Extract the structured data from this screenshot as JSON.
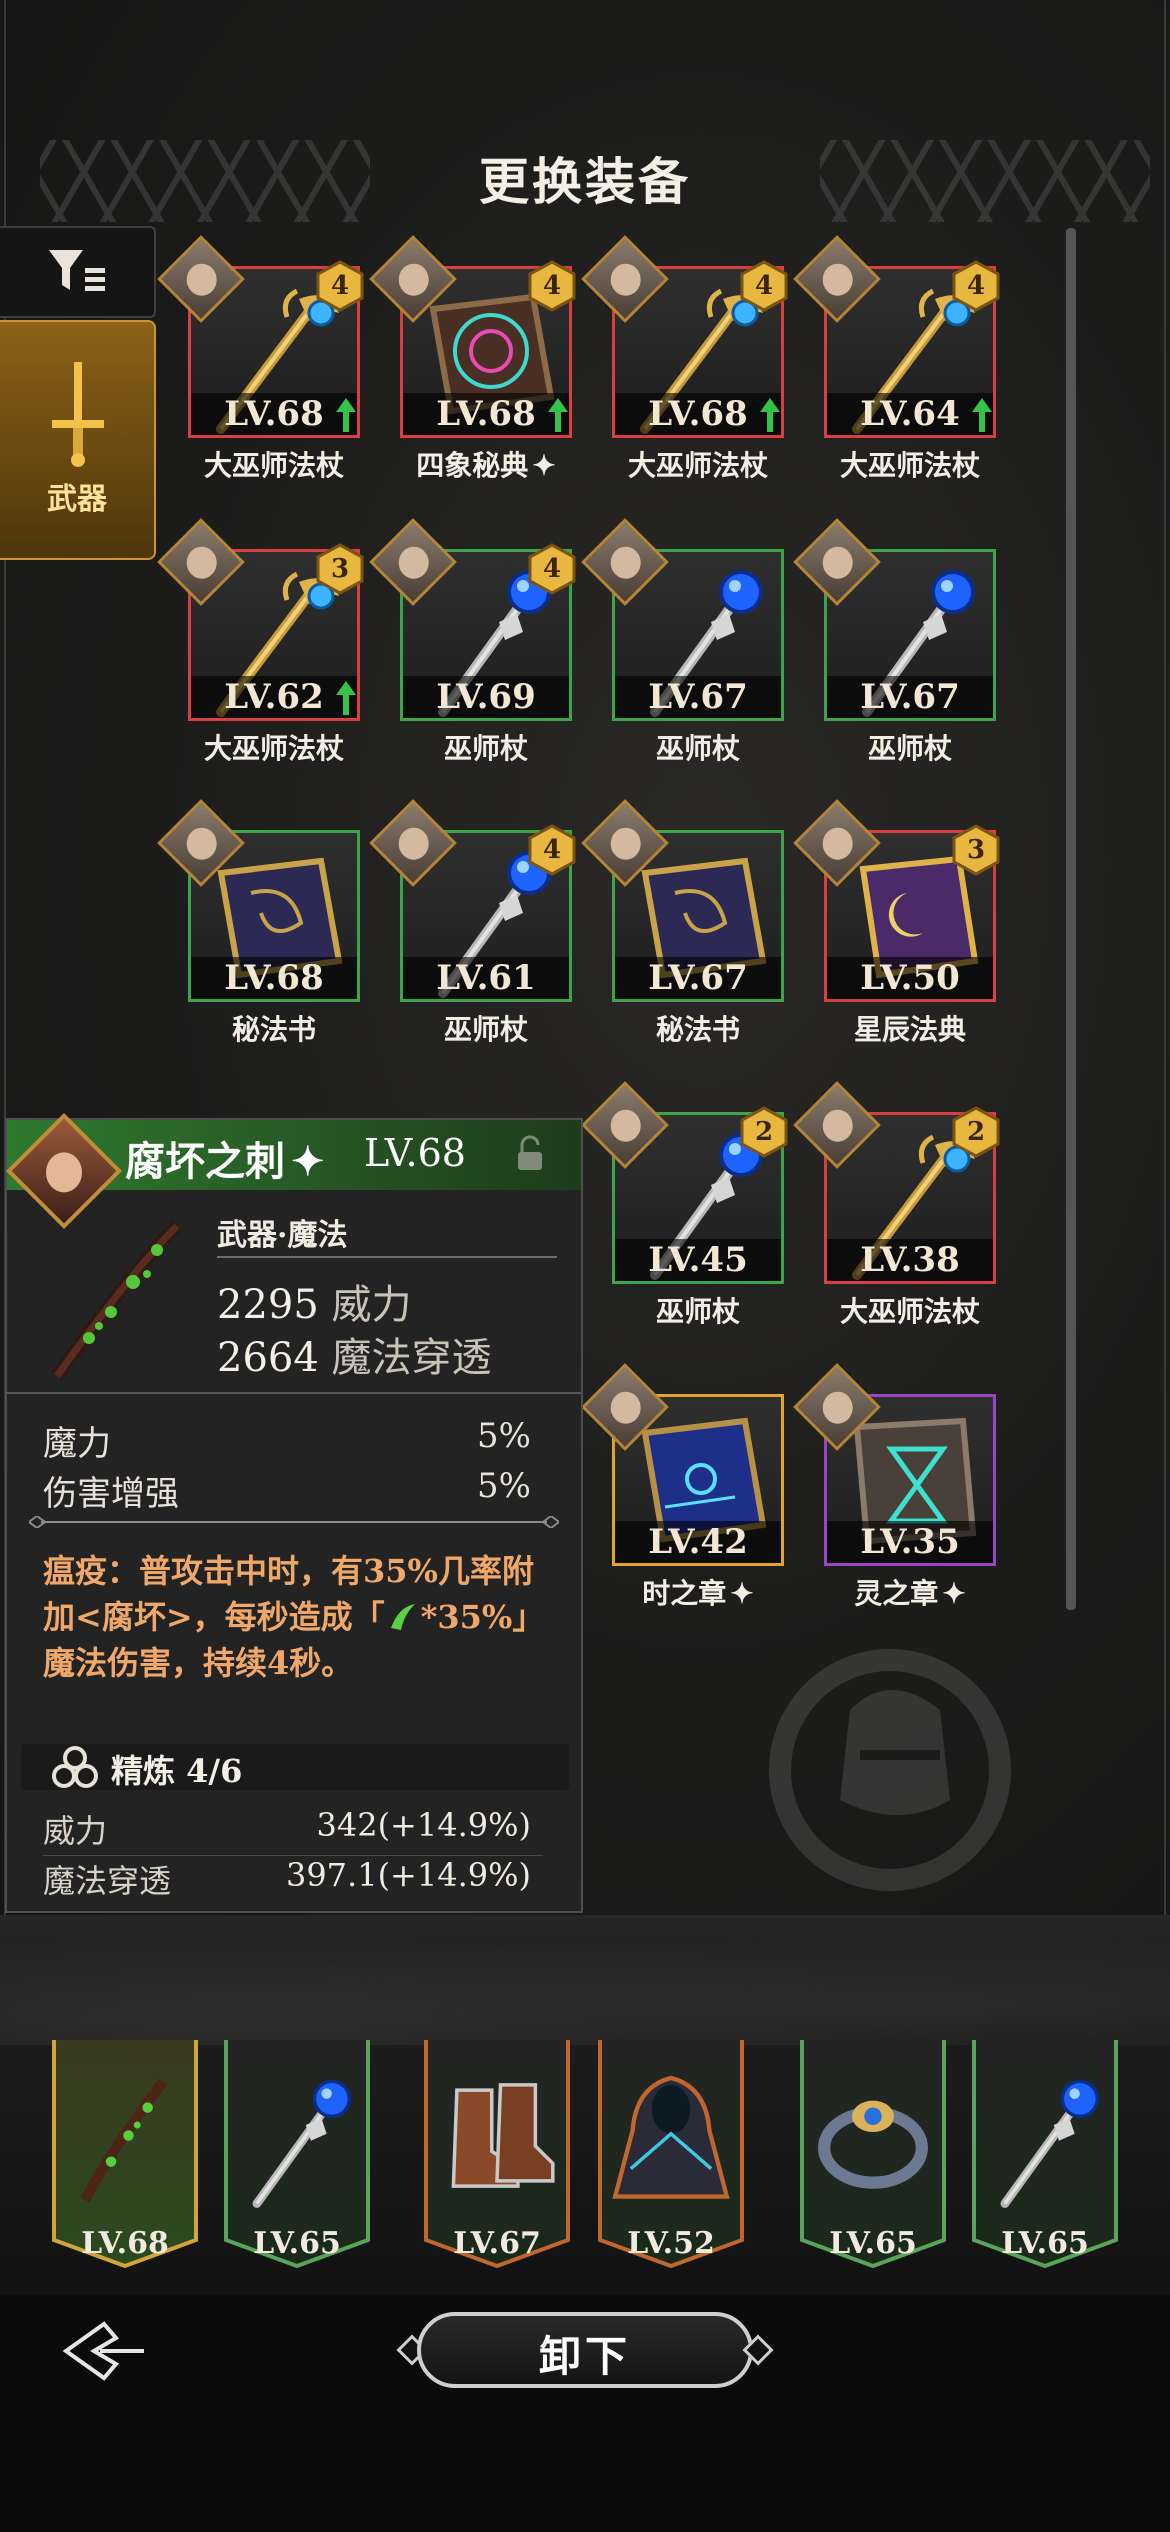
{
  "header": {
    "title": "更换装备"
  },
  "tabs": {
    "weapon_label": "武器"
  },
  "items": [
    {
      "name": "大巫师法杖",
      "level": "LV.68",
      "rarity": "red",
      "badge": "4",
      "upgrade": true,
      "art": "arch-staff"
    },
    {
      "name": "四象秘典",
      "star": "✦",
      "level": "LV.68",
      "rarity": "red",
      "badge": "4",
      "upgrade": true,
      "art": "tome-rune"
    },
    {
      "name": "大巫师法杖",
      "level": "LV.68",
      "rarity": "red",
      "badge": "4",
      "upgrade": true,
      "art": "arch-staff"
    },
    {
      "name": "大巫师法杖",
      "level": "LV.64",
      "rarity": "red",
      "badge": "4",
      "upgrade": true,
      "art": "arch-staff"
    },
    {
      "name": "大巫师法杖",
      "level": "LV.62",
      "rarity": "red",
      "badge": "3",
      "upgrade": true,
      "art": "arch-staff"
    },
    {
      "name": "巫师杖",
      "level": "LV.69",
      "rarity": "green",
      "badge": "4",
      "upgrade": false,
      "art": "staff"
    },
    {
      "name": "巫师杖",
      "level": "LV.67",
      "rarity": "green",
      "badge": "",
      "upgrade": false,
      "art": "staff"
    },
    {
      "name": "巫师杖",
      "level": "LV.67",
      "rarity": "green",
      "badge": "",
      "upgrade": false,
      "art": "staff"
    },
    {
      "name": "秘法书",
      "level": "LV.68",
      "rarity": "green",
      "badge": "",
      "upgrade": false,
      "art": "tome"
    },
    {
      "name": "巫师杖",
      "level": "LV.61",
      "rarity": "green",
      "badge": "4",
      "upgrade": false,
      "art": "staff"
    },
    {
      "name": "秘法书",
      "level": "LV.67",
      "rarity": "green",
      "badge": "",
      "upgrade": false,
      "art": "tome"
    },
    {
      "name": "星辰法典",
      "level": "LV.50",
      "rarity": "red",
      "badge": "3",
      "upgrade": false,
      "art": "tome-star"
    },
    {
      "name": "巫师杖",
      "level": "LV.45",
      "rarity": "green",
      "badge": "2",
      "upgrade": false,
      "art": "staff"
    },
    {
      "name": "大巫师法杖",
      "level": "LV.38",
      "rarity": "red",
      "badge": "2",
      "upgrade": false,
      "art": "arch-staff"
    },
    {
      "name": "时之章",
      "star": "✦",
      "level": "LV.42",
      "rarity": "gold",
      "badge": "",
      "upgrade": false,
      "art": "tome-blue"
    },
    {
      "name": "灵之章",
      "star": "✦",
      "level": "LV.35",
      "rarity": "purple",
      "badge": "",
      "upgrade": false,
      "art": "tome-teal"
    }
  ],
  "detail": {
    "name": "腐坏之刺",
    "star": "✦",
    "level": "LV.68",
    "type": "武器·魔法",
    "stat1_value": "2295",
    "stat1_unit": "威力",
    "stat2_value": "2664",
    "stat2_unit": "魔法穿透",
    "attr1_label": "魔力",
    "attr1_value": "5%",
    "attr2_label": "伤害增强",
    "attr2_value": "5%",
    "skill_text": "瘟疫：普攻击中时，有35%几率附加<腐坏>，每秒造成「",
    "skill_text2": "*35%」魔法伤害，持续4秒。",
    "refine_label": "精炼 4/6",
    "refine1_label": "威力",
    "refine1_value": "342(+14.9%)",
    "refine2_label": "魔法穿透",
    "refine2_value": "397.1(+14.9%)"
  },
  "equipped": [
    {
      "level": "LV.68",
      "border": "#d2a53a",
      "art": "thorn"
    },
    {
      "level": "LV.65",
      "border": "#5aa35a",
      "art": "staff"
    },
    {
      "level": "LV.67",
      "border": "#c0672e",
      "art": "boots"
    },
    {
      "level": "LV.52",
      "border": "#c0672e",
      "art": "cloak"
    },
    {
      "level": "LV.65",
      "border": "#5aa35a",
      "art": "bracelet"
    },
    {
      "level": "LV.65",
      "border": "#5aa35a",
      "art": "staff"
    }
  ],
  "actions": {
    "unequip_label": "卸下"
  },
  "colors": {
    "accent": "#c89530",
    "red": "#d7403f",
    "green": "#3fa34a",
    "purple": "#9a45c8",
    "skill": "#f0a86a"
  }
}
